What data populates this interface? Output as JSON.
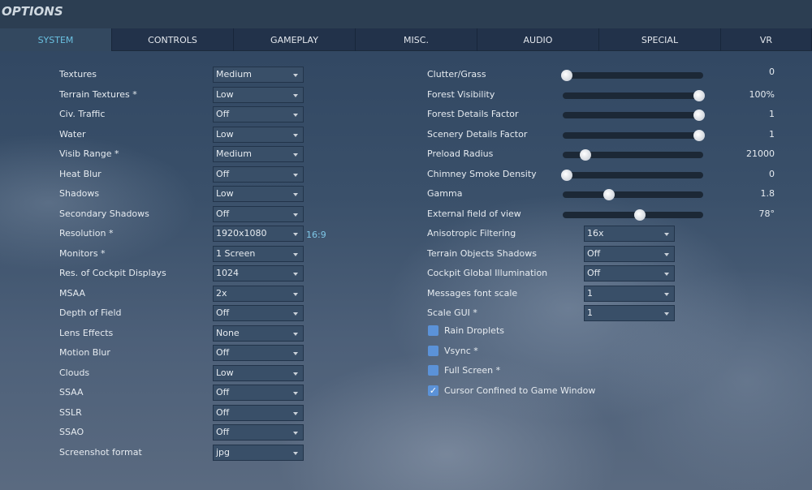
{
  "title": "OPTIONS",
  "tabs": [
    "SYSTEM",
    "CONTROLS",
    "GAMEPLAY",
    "MISC.",
    "AUDIO",
    "SPECIAL",
    "VR"
  ],
  "left": [
    {
      "label": "Textures",
      "value": "Medium"
    },
    {
      "label": "Terrain Textures *",
      "value": "Low"
    },
    {
      "label": "Civ. Traffic",
      "value": "Off"
    },
    {
      "label": "Water",
      "value": "Low"
    },
    {
      "label": "Visib Range *",
      "value": "Medium"
    },
    {
      "label": "Heat Blur",
      "value": "Off"
    },
    {
      "label": "Shadows",
      "value": "Low"
    },
    {
      "label": "Secondary Shadows",
      "value": "Off"
    },
    {
      "label": "Resolution *",
      "value": "1920x1080"
    },
    {
      "label": "Monitors *",
      "value": "1 Screen"
    },
    {
      "label": "Res. of Cockpit Displays",
      "value": "1024"
    },
    {
      "label": "MSAA",
      "value": "2x"
    },
    {
      "label": "Depth of Field",
      "value": "Off"
    },
    {
      "label": "Lens Effects",
      "value": "None"
    },
    {
      "label": "Motion Blur",
      "value": "Off"
    },
    {
      "label": "Clouds",
      "value": "Low"
    },
    {
      "label": "SSAA",
      "value": "Off"
    },
    {
      "label": "SSLR",
      "value": "Off"
    },
    {
      "label": "SSAO",
      "value": "Off"
    },
    {
      "label": "Screenshot format",
      "value": "jpg"
    }
  ],
  "aspect_ratio": "16:9",
  "sliders": [
    {
      "label": "Clutter/Grass",
      "value": "0",
      "fraction": 0
    },
    {
      "label": "Forest Visibility",
      "value": "100%",
      "fraction": 1
    },
    {
      "label": "Forest Details Factor",
      "value": "1",
      "fraction": 1
    },
    {
      "label": "Scenery Details Factor",
      "value": "1",
      "fraction": 1
    },
    {
      "label": "Preload Radius",
      "value": "21000",
      "fraction": 0.14
    },
    {
      "label": "Chimney Smoke Density",
      "value": "0",
      "fraction": 0
    },
    {
      "label": "Gamma",
      "value": "1.8",
      "fraction": 0.32
    },
    {
      "label": "External field of view",
      "value": "78°",
      "fraction": 0.55
    }
  ],
  "right_dropdowns": [
    {
      "label": "Anisotropic Filtering",
      "value": "16x"
    },
    {
      "label": "Terrain Objects Shadows",
      "value": "Off"
    },
    {
      "label": "Cockpit Global Illumination",
      "value": "Off"
    },
    {
      "label": "Messages font scale",
      "value": "1"
    },
    {
      "label": "Scale GUI *",
      "value": "1"
    }
  ],
  "checkboxes": [
    {
      "label": "Rain Droplets",
      "checked": false
    },
    {
      "label": "Vsync *",
      "checked": false
    },
    {
      "label": "Full Screen *",
      "checked": false
    },
    {
      "label": "Cursor Confined to Game Window",
      "checked": true
    }
  ]
}
